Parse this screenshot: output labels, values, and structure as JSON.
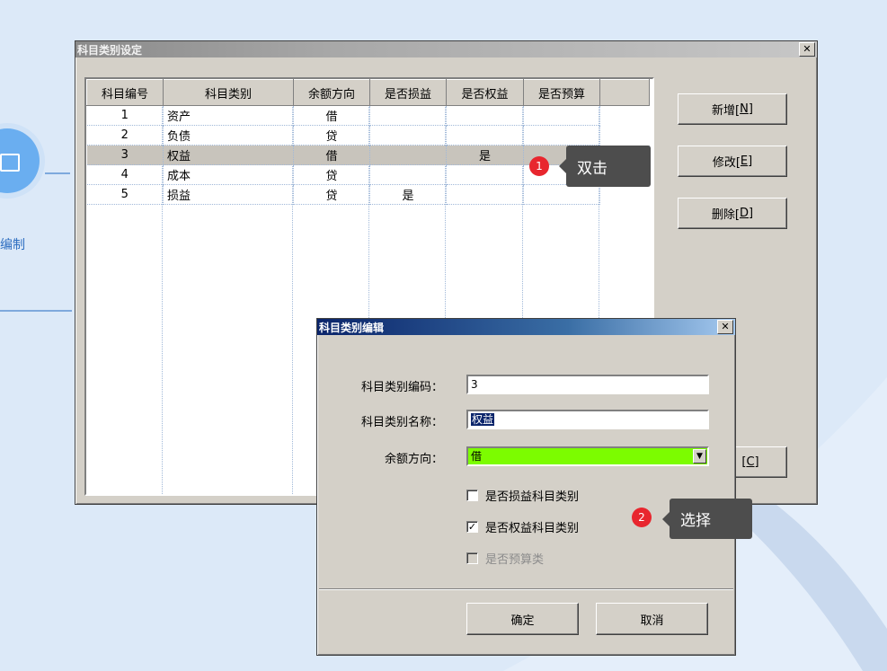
{
  "background": {
    "flow_label": "编制"
  },
  "main_window": {
    "title": "科目类别设定",
    "close_glyph": "✕",
    "columns": [
      "科目编号",
      "科目类别",
      "余额方向",
      "是否损益",
      "是否权益",
      "是否预算"
    ],
    "rows": [
      {
        "id": "1",
        "name": "资产",
        "direction": "借",
        "is_pl": "",
        "is_equity": "",
        "is_budget": ""
      },
      {
        "id": "2",
        "name": "负债",
        "direction": "贷",
        "is_pl": "",
        "is_equity": "",
        "is_budget": ""
      },
      {
        "id": "3",
        "name": "权益",
        "direction": "借",
        "is_pl": "",
        "is_equity": "是",
        "is_budget": ""
      },
      {
        "id": "4",
        "name": "成本",
        "direction": "贷",
        "is_pl": "",
        "is_equity": "",
        "is_budget": ""
      },
      {
        "id": "5",
        "name": "损益",
        "direction": "贷",
        "is_pl": "是",
        "is_equity": "",
        "is_budget": ""
      }
    ],
    "buttons": {
      "add": {
        "label": "新增[",
        "key": "N",
        "suffix": "]"
      },
      "edit": {
        "label": "修改[",
        "key": "E",
        "suffix": "]"
      },
      "delete": {
        "label": "删除[",
        "key": "D",
        "suffix": "]"
      },
      "close": {
        "label": "[",
        "key": "C",
        "suffix": "]"
      }
    }
  },
  "annotations": {
    "step1": {
      "number": "1",
      "text": "双击"
    },
    "step2": {
      "number": "2",
      "text": "选择"
    }
  },
  "dialog": {
    "title": "科目类别编辑",
    "close_glyph": "✕",
    "code_label": "科目类别编码：",
    "code_value": "3",
    "name_label": "科目类别名称：",
    "name_value": "权益",
    "direction_label": "余额方向：",
    "direction_value": "借",
    "combo_arrow": "▼",
    "cb_pl_label": "是否损益科目类别",
    "cb_equity_label": "是否权益科目类别",
    "cb_budget_label": "是否预算类",
    "check_glyph": "✓",
    "ok_label": "确定",
    "cancel_label": "取消"
  },
  "colors": {
    "desktop": "#dce9f8",
    "dialog_title": "#0a246a",
    "combo_highlight": "#7cfc00",
    "badge": "#e8262e"
  }
}
